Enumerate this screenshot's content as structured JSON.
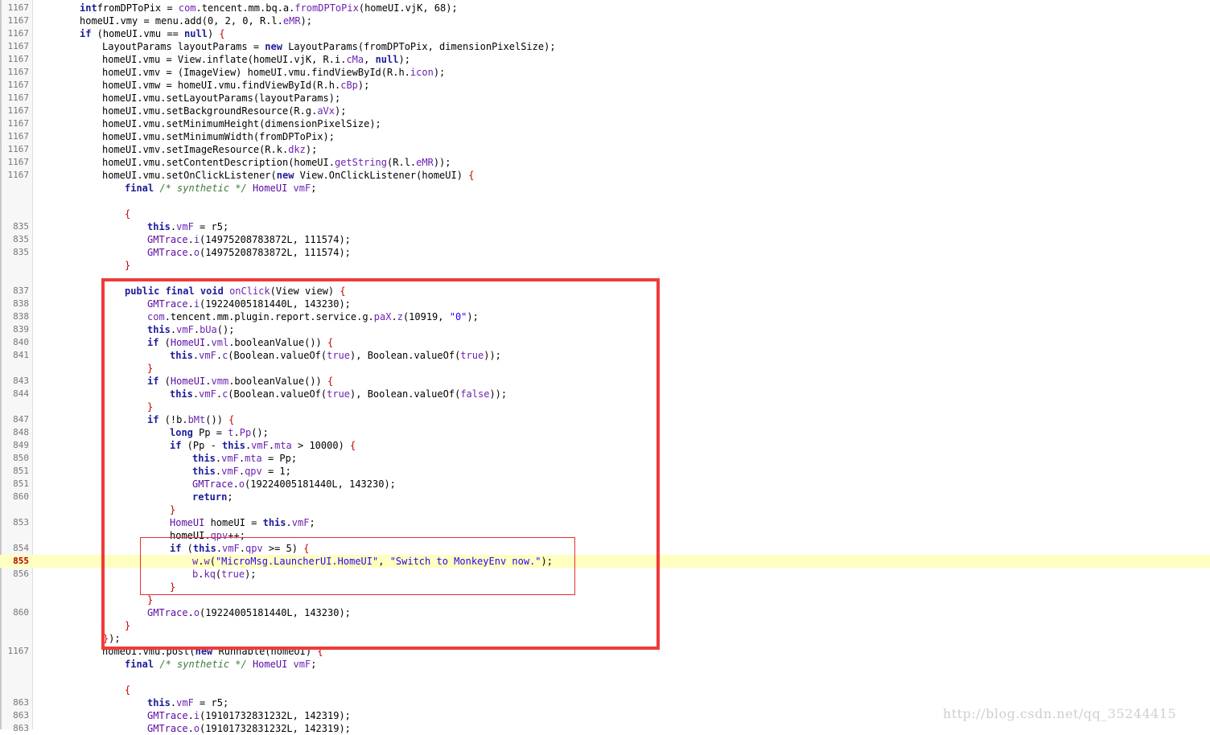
{
  "watermark": "http://blog.csdn.net/qq_35244415",
  "highlighted_line": "855",
  "lines": [
    {
      "n": "1167",
      "t": 0,
      "tokens": [
        [
          "kw",
          "int"
        ],
        [
          "",
          "fromDPToPix = "
        ],
        [
          "fld",
          "com"
        ],
        [
          "",
          ".tencent.mm.bq.a."
        ],
        [
          "fld",
          "fromDPToPix"
        ],
        [
          "",
          "(homeUI.vjK, 68);"
        ]
      ]
    },
    {
      "n": "1167",
      "t": 0,
      "tokens": [
        [
          "",
          "homeUI.vmy = menu.add(0, 2, 0, R.l."
        ],
        [
          "fld",
          "eMR"
        ],
        [
          "",
          ");"
        ]
      ]
    },
    {
      "n": "1167",
      "t": 0,
      "tokens": [
        [
          "kw",
          "if"
        ],
        [
          "",
          " (homeUI.vmu == "
        ],
        [
          "kw",
          "null"
        ],
        [
          "",
          ") "
        ],
        [
          "br",
          "{"
        ]
      ]
    },
    {
      "n": "1167",
      "t": 1,
      "tokens": [
        [
          "",
          "LayoutParams layoutParams = "
        ],
        [
          "kw",
          "new"
        ],
        [
          "",
          " LayoutParams(fromDPToPix, dimensionPixelSize);"
        ]
      ]
    },
    {
      "n": "1167",
      "t": 1,
      "tokens": [
        [
          "",
          "homeUI.vmu = View.inflate(homeUI.vjK, R.i."
        ],
        [
          "fld",
          "cMa"
        ],
        [
          "",
          ", "
        ],
        [
          "kw",
          "null"
        ],
        [
          "",
          ");"
        ]
      ]
    },
    {
      "n": "1167",
      "t": 1,
      "tokens": [
        [
          "",
          "homeUI.vmv = (ImageView) homeUI.vmu.findViewById(R.h."
        ],
        [
          "fld",
          "icon"
        ],
        [
          "",
          ");"
        ]
      ]
    },
    {
      "n": "1167",
      "t": 1,
      "tokens": [
        [
          "",
          "homeUI.vmw = homeUI.vmu.findViewById(R.h."
        ],
        [
          "fld",
          "cBp"
        ],
        [
          "",
          ");"
        ]
      ]
    },
    {
      "n": "1167",
      "t": 1,
      "tokens": [
        [
          "",
          "homeUI.vmu.setLayoutParams(layoutParams);"
        ]
      ]
    },
    {
      "n": "1167",
      "t": 1,
      "tokens": [
        [
          "",
          "homeUI.vmu.setBackgroundResource(R.g."
        ],
        [
          "fld",
          "aVx"
        ],
        [
          "",
          ");"
        ]
      ]
    },
    {
      "n": "1167",
      "t": 1,
      "tokens": [
        [
          "",
          "homeUI.vmu.setMinimumHeight(dimensionPixelSize);"
        ]
      ]
    },
    {
      "n": "1167",
      "t": 1,
      "tokens": [
        [
          "",
          "homeUI.vmu.setMinimumWidth(fromDPToPix);"
        ]
      ]
    },
    {
      "n": "1167",
      "t": 1,
      "tokens": [
        [
          "",
          "homeUI.vmv.setImageResource(R.k."
        ],
        [
          "fld",
          "dkz"
        ],
        [
          "",
          ");"
        ]
      ]
    },
    {
      "n": "1167",
      "t": 1,
      "tokens": [
        [
          "",
          "homeUI.vmu.setContentDescription(homeUI."
        ],
        [
          "fld",
          "getString"
        ],
        [
          "",
          "(R.l."
        ],
        [
          "fld",
          "eMR"
        ],
        [
          "",
          "));"
        ]
      ]
    },
    {
      "n": "1167",
      "t": 1,
      "tokens": [
        [
          "",
          "homeUI.vmu.setOnClickListener("
        ],
        [
          "kw",
          "new"
        ],
        [
          "",
          " View.OnClickListener(homeUI) "
        ],
        [
          "br",
          "{"
        ]
      ]
    },
    {
      "n": "",
      "t": 2,
      "tokens": [
        [
          "kw",
          "final"
        ],
        [
          "",
          ""
        ],
        [
          "cm",
          " /* synthetic */ "
        ],
        [
          "ty",
          "HomeUI"
        ],
        [
          "",
          " "
        ],
        [
          "fld",
          "vmF"
        ],
        [
          "",
          ";"
        ]
      ]
    },
    {
      "n": "",
      "t": 2,
      "tokens": []
    },
    {
      "n": "",
      "t": 2,
      "tokens": [
        [
          "br",
          "{"
        ]
      ]
    },
    {
      "n": "835",
      "t": 3,
      "tokens": [
        [
          "kw",
          "this"
        ],
        [
          "",
          "."
        ],
        [
          "fld",
          "vmF"
        ],
        [
          "",
          " = r5;"
        ]
      ]
    },
    {
      "n": "835",
      "t": 3,
      "tokens": [
        [
          "ty",
          "GMTrace"
        ],
        [
          "",
          "."
        ],
        [
          "fld",
          "i"
        ],
        [
          "",
          "(14975208783872L, 111574);"
        ]
      ]
    },
    {
      "n": "835",
      "t": 3,
      "tokens": [
        [
          "ty",
          "GMTrace"
        ],
        [
          "",
          "."
        ],
        [
          "fld",
          "o"
        ],
        [
          "",
          "(14975208783872L, 111574);"
        ]
      ]
    },
    {
      "n": "",
      "t": 2,
      "tokens": [
        [
          "br",
          "}"
        ]
      ]
    },
    {
      "n": "",
      "t": 2,
      "tokens": []
    },
    {
      "n": "837",
      "t": 2,
      "tokens": [
        [
          "kw",
          "public final void"
        ],
        [
          "",
          " "
        ],
        [
          "fld",
          "onClick"
        ],
        [
          "",
          "(View view) "
        ],
        [
          "br",
          "{"
        ]
      ]
    },
    {
      "n": "838",
      "t": 3,
      "tokens": [
        [
          "ty",
          "GMTrace"
        ],
        [
          "",
          "."
        ],
        [
          "fld",
          "i"
        ],
        [
          "",
          "(19224005181440L, 143230);"
        ]
      ]
    },
    {
      "n": "838",
      "t": 3,
      "tokens": [
        [
          "fld",
          "com"
        ],
        [
          "",
          ".tencent.mm.plugin.report.service.g."
        ],
        [
          "fld",
          "paX"
        ],
        [
          "",
          "."
        ],
        [
          "fld",
          "z"
        ],
        [
          "",
          "(10919, "
        ],
        [
          "str",
          "\"0\""
        ],
        [
          "",
          ");"
        ]
      ]
    },
    {
      "n": "839",
      "t": 3,
      "tokens": [
        [
          "kw",
          "this"
        ],
        [
          "",
          "."
        ],
        [
          "fld",
          "vmF"
        ],
        [
          "",
          "."
        ],
        [
          "fld",
          "bUa"
        ],
        [
          "",
          "();"
        ]
      ]
    },
    {
      "n": "840",
      "t": 3,
      "tokens": [
        [
          "kw",
          "if"
        ],
        [
          "",
          " ("
        ],
        [
          "ty",
          "HomeUI"
        ],
        [
          "",
          "."
        ],
        [
          "fld",
          "vml"
        ],
        [
          "",
          ".booleanValue()) "
        ],
        [
          "br",
          "{"
        ]
      ]
    },
    {
      "n": "841",
      "t": 4,
      "tokens": [
        [
          "kw",
          "this"
        ],
        [
          "",
          "."
        ],
        [
          "fld",
          "vmF"
        ],
        [
          "",
          "."
        ],
        [
          "fld",
          "c"
        ],
        [
          "",
          "(Boolean.valueOf("
        ],
        [
          "fld",
          "true"
        ],
        [
          "",
          "), Boolean.valueOf("
        ],
        [
          "fld",
          "true"
        ],
        [
          "",
          "));"
        ]
      ]
    },
    {
      "n": "",
      "t": 3,
      "tokens": [
        [
          "br",
          "}"
        ]
      ]
    },
    {
      "n": "843",
      "t": 3,
      "tokens": [
        [
          "kw",
          "if"
        ],
        [
          "",
          " ("
        ],
        [
          "ty",
          "HomeUI"
        ],
        [
          "",
          "."
        ],
        [
          "fld",
          "vmm"
        ],
        [
          "",
          ".booleanValue()) "
        ],
        [
          "br",
          "{"
        ]
      ]
    },
    {
      "n": "844",
      "t": 4,
      "tokens": [
        [
          "kw",
          "this"
        ],
        [
          "",
          "."
        ],
        [
          "fld",
          "vmF"
        ],
        [
          "",
          "."
        ],
        [
          "fld",
          "c"
        ],
        [
          "",
          "(Boolean.valueOf("
        ],
        [
          "fld",
          "true"
        ],
        [
          "",
          "), Boolean.valueOf("
        ],
        [
          "fld",
          "false"
        ],
        [
          "",
          "));"
        ]
      ]
    },
    {
      "n": "",
      "t": 3,
      "tokens": [
        [
          "br",
          "}"
        ]
      ]
    },
    {
      "n": "847",
      "t": 3,
      "tokens": [
        [
          "kw",
          "if"
        ],
        [
          "",
          " (!b."
        ],
        [
          "fld",
          "bMt"
        ],
        [
          "",
          "()) "
        ],
        [
          "br",
          "{"
        ]
      ]
    },
    {
      "n": "848",
      "t": 4,
      "tokens": [
        [
          "kw",
          "long"
        ],
        [
          "",
          " Pp = "
        ],
        [
          "fld",
          "t"
        ],
        [
          "",
          "."
        ],
        [
          "fld",
          "Pp"
        ],
        [
          "",
          "();"
        ]
      ]
    },
    {
      "n": "849",
      "t": 4,
      "tokens": [
        [
          "kw",
          "if"
        ],
        [
          "",
          " (Pp - "
        ],
        [
          "kw",
          "this"
        ],
        [
          "",
          "."
        ],
        [
          "fld",
          "vmF"
        ],
        [
          "",
          "."
        ],
        [
          "fld",
          "mta"
        ],
        [
          "",
          " > 10000) "
        ],
        [
          "br",
          "{"
        ]
      ]
    },
    {
      "n": "850",
      "t": 5,
      "tokens": [
        [
          "kw",
          "this"
        ],
        [
          "",
          "."
        ],
        [
          "fld",
          "vmF"
        ],
        [
          "",
          "."
        ],
        [
          "fld",
          "mta"
        ],
        [
          "",
          " = Pp;"
        ]
      ]
    },
    {
      "n": "851",
      "t": 5,
      "tokens": [
        [
          "kw",
          "this"
        ],
        [
          "",
          "."
        ],
        [
          "fld",
          "vmF"
        ],
        [
          "",
          "."
        ],
        [
          "fld",
          "qpv"
        ],
        [
          "",
          " = 1;"
        ]
      ]
    },
    {
      "n": "851",
      "t": 5,
      "tokens": [
        [
          "ty",
          "GMTrace"
        ],
        [
          "",
          "."
        ],
        [
          "fld",
          "o"
        ],
        [
          "",
          "(19224005181440L, 143230);"
        ]
      ]
    },
    {
      "n": "860",
      "t": 5,
      "tokens": [
        [
          "kw",
          "return"
        ],
        [
          "",
          ";"
        ]
      ]
    },
    {
      "n": "",
      "t": 4,
      "tokens": [
        [
          "br",
          "}"
        ]
      ]
    },
    {
      "n": "853",
      "t": 4,
      "tokens": [
        [
          "ty",
          "HomeUI"
        ],
        [
          "",
          " homeUI = "
        ],
        [
          "kw",
          "this"
        ],
        [
          "",
          "."
        ],
        [
          "fld",
          "vmF"
        ],
        [
          "",
          ";"
        ]
      ]
    },
    {
      "n": "",
      "t": 4,
      "tokens": [
        [
          "",
          "homeUI."
        ],
        [
          "fld",
          "qpv"
        ],
        [
          "",
          "++;"
        ]
      ]
    },
    {
      "n": "854",
      "t": 4,
      "tokens": [
        [
          "kw",
          "if"
        ],
        [
          "",
          " ("
        ],
        [
          "kw",
          "this"
        ],
        [
          "",
          "."
        ],
        [
          "fld",
          "vmF"
        ],
        [
          "",
          "."
        ],
        [
          "fld",
          "qpv"
        ],
        [
          "",
          " >= 5) "
        ],
        [
          "br",
          "{"
        ]
      ]
    },
    {
      "n": "855",
      "t": 5,
      "hl": true,
      "tokens": [
        [
          "fld",
          "w"
        ],
        [
          "",
          "."
        ],
        [
          "fld",
          "w"
        ],
        [
          "",
          "("
        ],
        [
          "str",
          "\"MicroMsg.LauncherUI.HomeUI\""
        ],
        [
          "",
          ", "
        ],
        [
          "str",
          "\"Switch to MonkeyEnv now.\""
        ],
        [
          "",
          ");"
        ]
      ]
    },
    {
      "n": "856",
      "t": 5,
      "tokens": [
        [
          "fld",
          "b"
        ],
        [
          "",
          "."
        ],
        [
          "fld",
          "kq"
        ],
        [
          "",
          "("
        ],
        [
          "fld",
          "true"
        ],
        [
          "",
          ");"
        ]
      ]
    },
    {
      "n": "",
      "t": 4,
      "tokens": [
        [
          "br",
          "}"
        ]
      ]
    },
    {
      "n": "",
      "t": 3,
      "tokens": [
        [
          "br",
          "}"
        ]
      ]
    },
    {
      "n": "860",
      "t": 3,
      "tokens": [
        [
          "ty",
          "GMTrace"
        ],
        [
          "",
          "."
        ],
        [
          "fld",
          "o"
        ],
        [
          "",
          "(19224005181440L, 143230);"
        ]
      ]
    },
    {
      "n": "",
      "t": 2,
      "tokens": [
        [
          "br",
          "}"
        ]
      ]
    },
    {
      "n": "",
      "t": 0,
      "tokens": [
        [
          "",
          "    "
        ],
        [
          "br",
          "}"
        ],
        [
          "",
          ");"
        ]
      ]
    },
    {
      "n": "1167",
      "t": 1,
      "tokens": [
        [
          "",
          "homeUI.vmu.post("
        ],
        [
          "kw",
          "new"
        ],
        [
          "",
          " Runnable(homeUI) "
        ],
        [
          "br",
          "{"
        ]
      ]
    },
    {
      "n": "",
      "t": 2,
      "tokens": [
        [
          "kw",
          "final"
        ],
        [
          "cm",
          " /* synthetic */ "
        ],
        [
          "ty",
          "HomeUI"
        ],
        [
          "",
          " "
        ],
        [
          "fld",
          "vmF"
        ],
        [
          "",
          ";"
        ]
      ]
    },
    {
      "n": "",
      "t": 2,
      "tokens": []
    },
    {
      "n": "",
      "t": 2,
      "tokens": [
        [
          "br",
          "{"
        ]
      ]
    },
    {
      "n": "863",
      "t": 3,
      "tokens": [
        [
          "kw",
          "this"
        ],
        [
          "",
          "."
        ],
        [
          "fld",
          "vmF"
        ],
        [
          "",
          " = r5;"
        ]
      ]
    },
    {
      "n": "863",
      "t": 3,
      "tokens": [
        [
          "ty",
          "GMTrace"
        ],
        [
          "",
          "."
        ],
        [
          "fld",
          "i"
        ],
        [
          "",
          "(19101732831232L, 142319);"
        ]
      ]
    },
    {
      "n": "863",
      "t": 3,
      "tokens": [
        [
          "ty",
          "GMTrace"
        ],
        [
          "",
          "."
        ],
        [
          "fld",
          "o"
        ],
        [
          "",
          "(19101732831232L, 142319);"
        ]
      ]
    }
  ]
}
